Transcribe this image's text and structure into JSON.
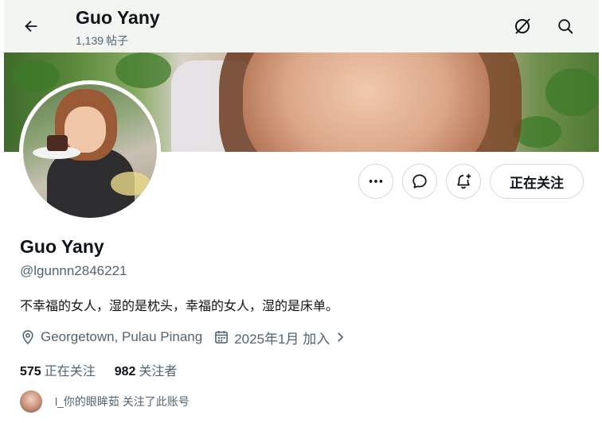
{
  "header": {
    "title": "Guo Yany",
    "post_count": "1,139",
    "post_label": "帖子"
  },
  "icons": {
    "back": "arrow-left-icon",
    "grok": "grok-icon",
    "search": "search-icon",
    "more": "more-horizontal-icon",
    "message": "message-icon",
    "notify": "bell-plus-icon",
    "location": "location-pin-icon",
    "calendar": "calendar-icon",
    "chevron": "chevron-right-icon"
  },
  "actions": {
    "follow_label": "正在关注"
  },
  "profile": {
    "name": "Guo Yany",
    "handle": "@lgunnn2846221",
    "bio": "不幸福的女人，湿的是枕头，幸福的女人，湿的是床单。",
    "location": "Georgetown, Pulau Pinang",
    "joined": "2025年1月 加入"
  },
  "stats": {
    "following_count": "575",
    "following_label": "正在关注",
    "followers_count": "982",
    "followers_label": "关注者"
  },
  "mutual": {
    "text": "l_你的眼眸茹 关注了此账号"
  },
  "colors": {
    "text_primary": "#0f1419",
    "text_secondary": "#536471",
    "border": "#cfd9de"
  }
}
